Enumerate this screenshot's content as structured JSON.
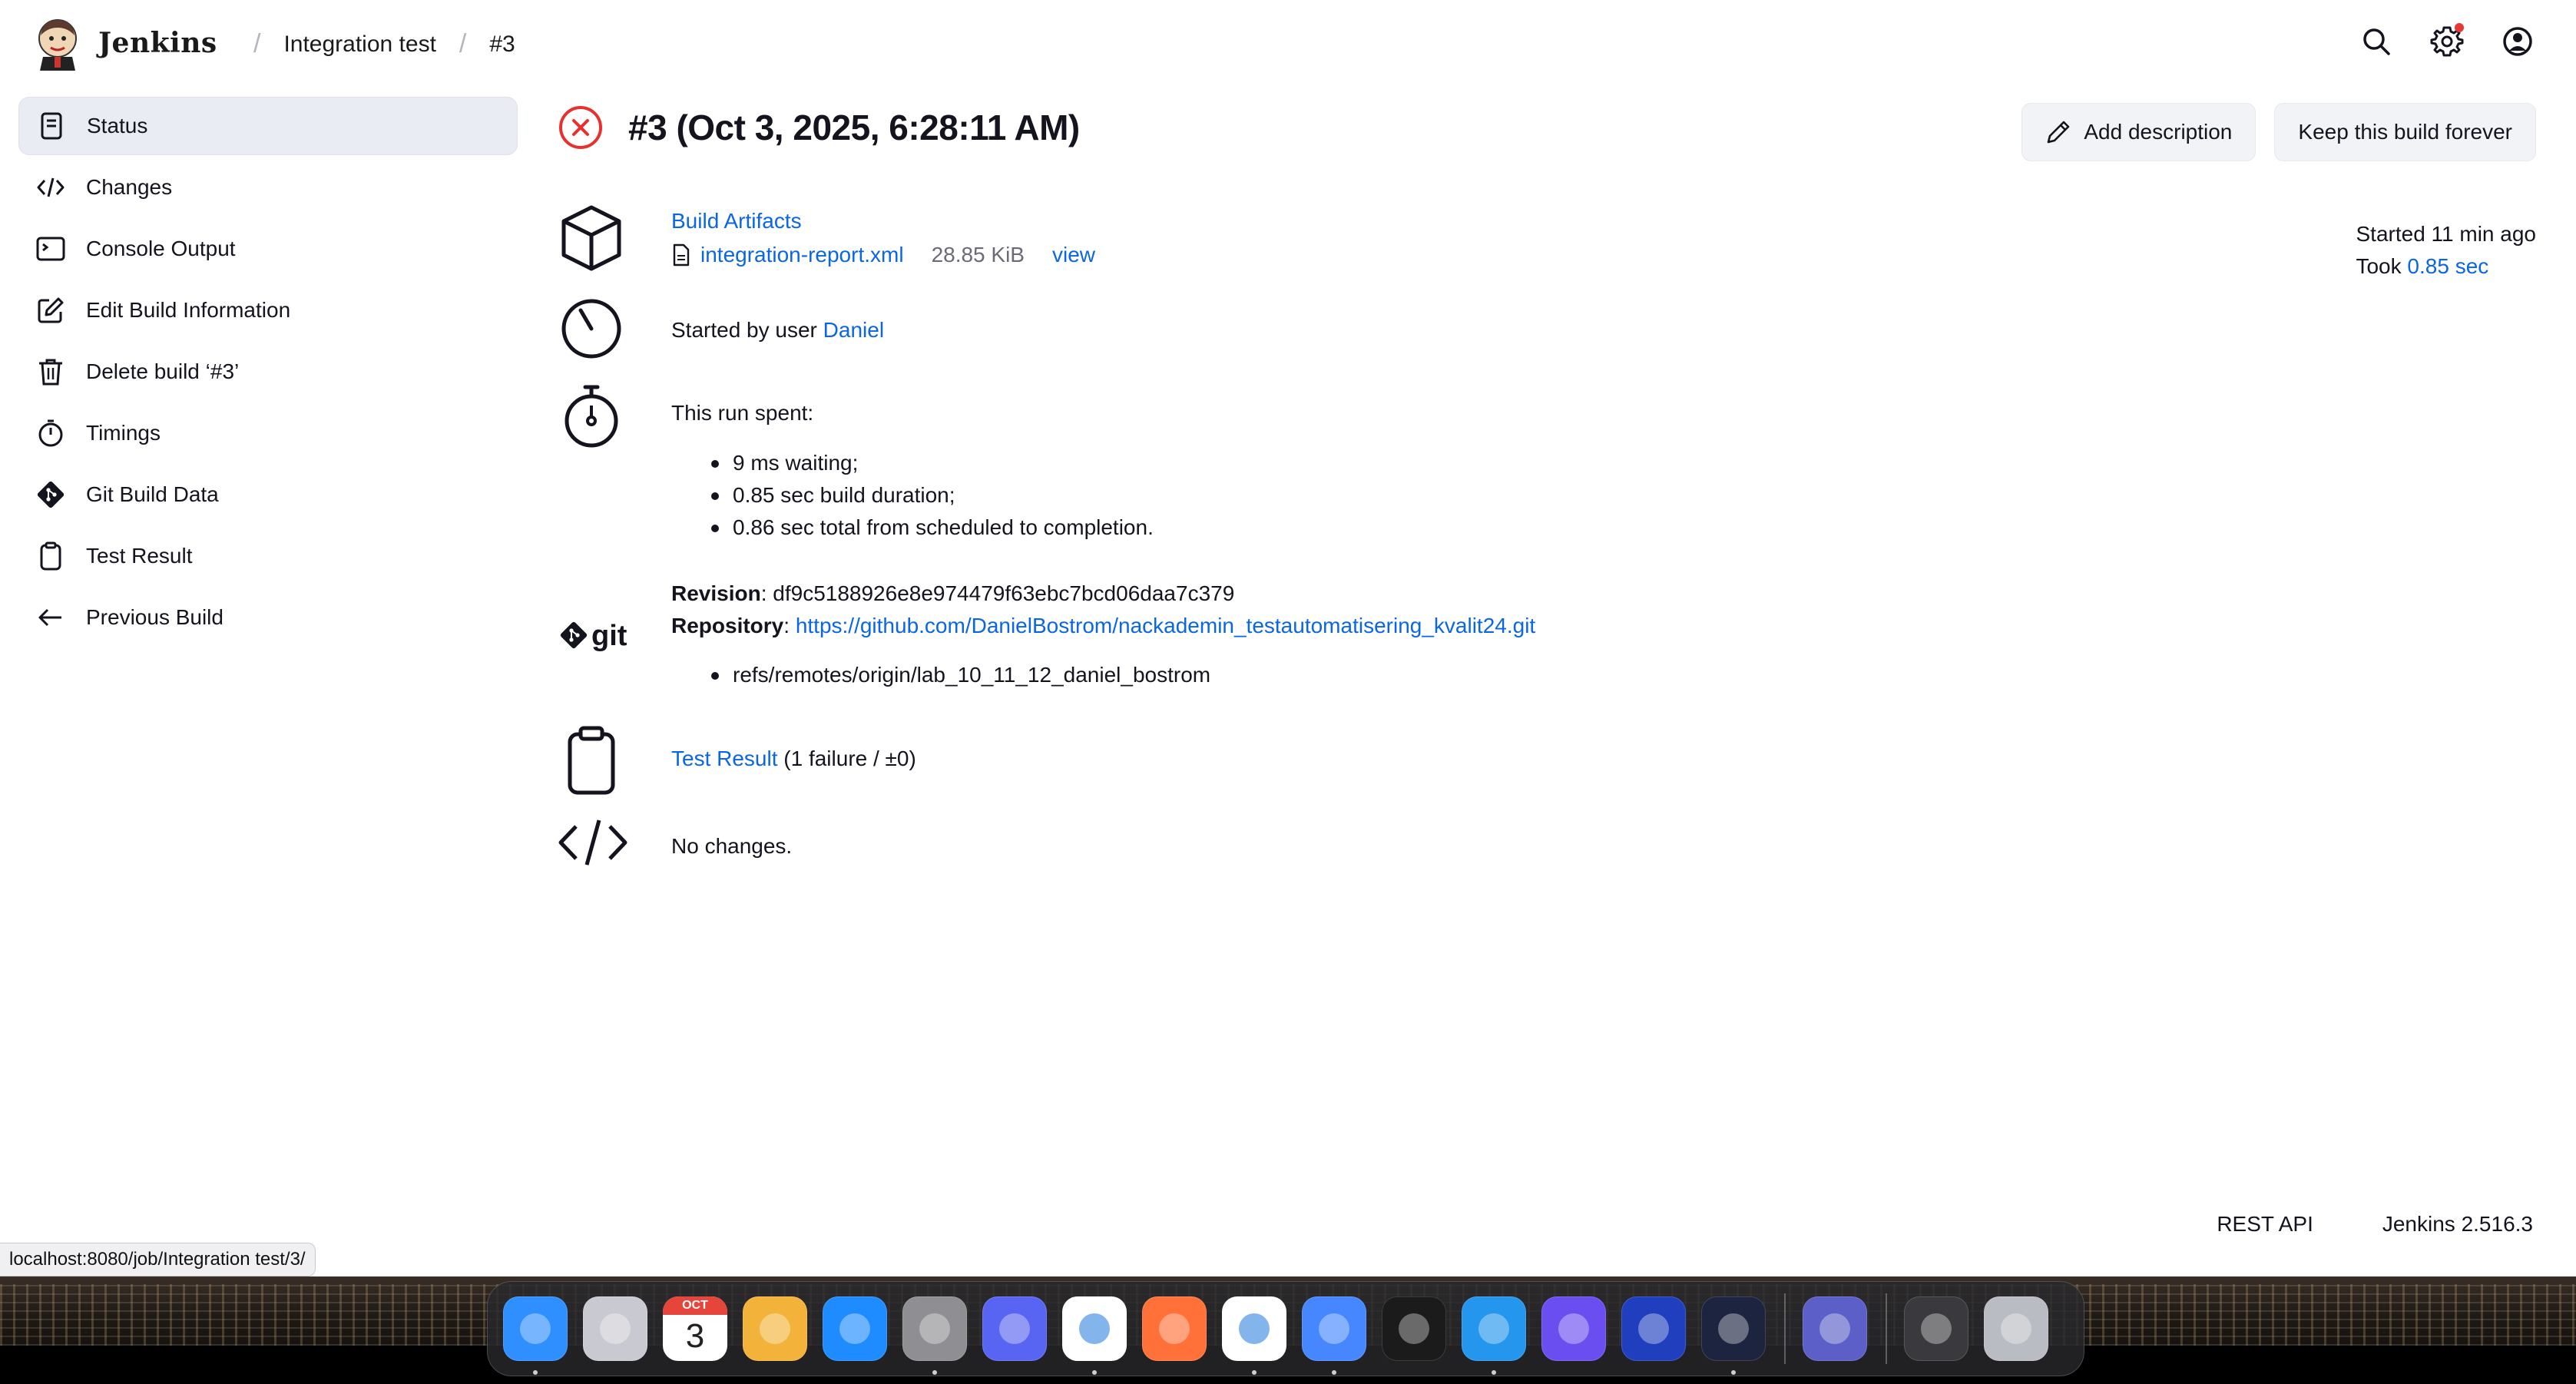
{
  "header": {
    "brand": "Jenkins",
    "breadcrumbs": [
      "Integration test",
      "#3"
    ]
  },
  "sidebar": {
    "items": [
      {
        "label": "Status",
        "icon": "status-doc-icon"
      },
      {
        "label": "Changes",
        "icon": "code-icon"
      },
      {
        "label": "Console Output",
        "icon": "terminal-icon"
      },
      {
        "label": "Edit Build Information",
        "icon": "edit-icon"
      },
      {
        "label": "Delete build ‘#3’",
        "icon": "trash-icon"
      },
      {
        "label": "Timings",
        "icon": "stopwatch-icon"
      },
      {
        "label": "Git Build Data",
        "icon": "git-icon"
      },
      {
        "label": "Test Result",
        "icon": "clipboard-icon"
      },
      {
        "label": "Previous Build",
        "icon": "arrow-left-icon"
      }
    ]
  },
  "build": {
    "title": "#3 (Oct 3, 2025, 6:28:11 AM)",
    "status": "failed",
    "add_description": "Add description",
    "keep_forever": "Keep this build forever",
    "started_ago": "Started 11 min ago",
    "took_label": "Took",
    "took_value": "0.85 sec"
  },
  "artifacts": {
    "heading": "Build Artifacts",
    "file_name": "integration-report.xml",
    "file_size": "28.85 KiB",
    "view": "view"
  },
  "cause": {
    "text": "Started by user",
    "user": "Daniel"
  },
  "timing": {
    "heading": "This run spent:",
    "items": [
      "9 ms waiting;",
      "0.85 sec build duration;",
      "0.86 sec total from scheduled to completion."
    ]
  },
  "git": {
    "logo_text": "git",
    "revision_label": "Revision",
    "revision": "df9c5188926e8e974479f63ebc7bcd06daa7c379",
    "repository_label": "Repository",
    "repository": "https://github.com/DanielBostrom/nackademin_testautomatisering_kvalit24.git",
    "refs": [
      "refs/remotes/origin/lab_10_11_12_daniel_bostrom"
    ]
  },
  "tests": {
    "link": "Test Result",
    "summary": "(1 failure / ±0)"
  },
  "changes": {
    "text": "No changes."
  },
  "footer": {
    "rest_api": "REST API",
    "version": "Jenkins 2.516.3"
  },
  "status_bar": {
    "url": "localhost:8080/job/Integration test/3/"
  },
  "dock": {
    "calendar_month": "OCT",
    "calendar_day": "3",
    "apps": [
      {
        "name": "finder-icon",
        "color": "#2f8fff",
        "running": true
      },
      {
        "name": "launchpad-icon",
        "color": "#c9c9d1",
        "running": false
      },
      {
        "name": "calendar-icon",
        "color": "#ffffff",
        "running": false
      },
      {
        "name": "pages-icon",
        "color": "#f3b23a",
        "running": false
      },
      {
        "name": "app-store-icon",
        "color": "#1e8cff",
        "running": false
      },
      {
        "name": "system-settings-icon",
        "color": "#8e8e93",
        "running": true
      },
      {
        "name": "discord-icon",
        "color": "#5865f2",
        "running": false
      },
      {
        "name": "chrome-icon",
        "color": "#ffffff",
        "running": true
      },
      {
        "name": "firefox-icon",
        "color": "#ff7139",
        "running": false
      },
      {
        "name": "vscode-icon",
        "color": "#ffffff",
        "running": true
      },
      {
        "name": "nordvpn-icon",
        "color": "#4687ff",
        "running": true
      },
      {
        "name": "activity-monitor-icon",
        "color": "#1b1b1b",
        "running": false
      },
      {
        "name": "docker-icon",
        "color": "#2496ed",
        "running": true
      },
      {
        "name": "linear-icon",
        "color": "#6b4ef0",
        "running": false
      },
      {
        "name": "vpn-client-icon",
        "color": "#1f3fbf",
        "running": false
      },
      {
        "name": "terminal-app-icon",
        "color": "#1c2440",
        "running": true
      }
    ],
    "recent": [
      {
        "name": "recent-app-icon",
        "color": "#5b5fc7"
      }
    ],
    "trailing": [
      {
        "name": "downloads-stack-icon",
        "color": "#3a3a3e"
      },
      {
        "name": "trash-app-icon",
        "color": "#b9bcc2"
      }
    ]
  }
}
